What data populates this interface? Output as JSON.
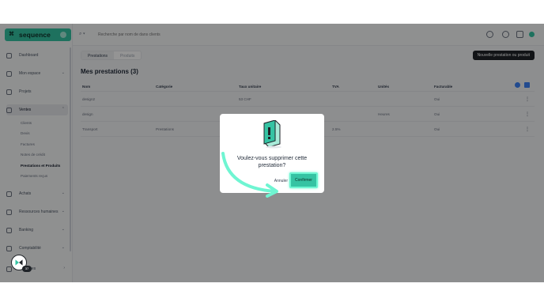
{
  "brand": {
    "name": "sequence",
    "accent": "#35c3a3"
  },
  "sidebar": {
    "items": [
      {
        "label": "Dashboard",
        "icon": "home-icon"
      },
      {
        "label": "Mon espace",
        "icon": "user-icon"
      },
      {
        "label": "Projets",
        "icon": "check-icon"
      },
      {
        "label": "Ventes",
        "icon": "bag-icon"
      },
      {
        "label": "Achats",
        "icon": "cart-icon"
      },
      {
        "label": "Ressources humaines",
        "icon": "people-icon"
      },
      {
        "label": "Banking",
        "icon": "bank-icon"
      },
      {
        "label": "Comptabilité",
        "icon": "ledger-icon"
      },
      {
        "label": "Réglages",
        "icon": "gear-icon"
      }
    ],
    "sub_items": [
      "Clients",
      "Devis",
      "Factures",
      "Notes de crédit",
      "Prestations et Produits",
      "Paiements reçus"
    ]
  },
  "topbar": {
    "search_placeholder": "Recherche par nom de dans clients"
  },
  "main": {
    "tabs": [
      "Prestations",
      "Produits"
    ],
    "new_button": "Nouvelle prestation ou produit",
    "title": "Mes prestations (3)",
    "columns": [
      "Nom",
      "Catégorie",
      "Taux unitaire",
      "TVA",
      "Unités",
      "Facturable"
    ],
    "rows": [
      [
        "design2",
        "",
        "53 CHF",
        "",
        "",
        "Oui"
      ],
      [
        "design",
        "",
        "",
        "",
        "Heures",
        "Oui"
      ],
      [
        "Transport",
        "Prestations",
        "",
        "2.5%",
        "",
        "Oui"
      ]
    ]
  },
  "modal": {
    "message": "Voulez-vous supprimer cette prestation?",
    "cancel_label": "Annuler",
    "confirm_label": "Confirmer"
  },
  "help": {
    "badge": "37"
  }
}
